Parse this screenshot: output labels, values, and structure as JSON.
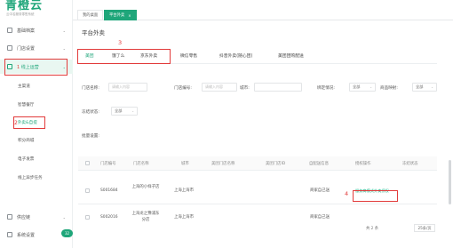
{
  "app": {
    "logo_text": "青橙云",
    "logo_sub": "云中名服务零售系统"
  },
  "sidebar": {
    "items": [
      {
        "label": "基础档案",
        "chevron": "⌄"
      },
      {
        "label": "门店设置",
        "chevron": "⌄"
      },
      {
        "label": "线上运营",
        "chevron": "⌄",
        "prefix": "1"
      },
      {
        "label": "供应链",
        "chevron": "⌄"
      },
      {
        "label": "系统设置",
        "chevron": "⌄"
      }
    ],
    "sub_items": [
      {
        "label": "主渠道"
      },
      {
        "label": "智慧餐厅"
      },
      {
        "label": "外卖&自提",
        "prefix": "2"
      },
      {
        "label": "积分商城"
      },
      {
        "label": "电子发票"
      },
      {
        "label": "线上异步任务"
      }
    ],
    "badge": "32"
  },
  "tabs": [
    {
      "label": "我的桌面"
    },
    {
      "label": "平台外卖",
      "close": "×"
    }
  ],
  "page": {
    "title": "平台外卖"
  },
  "channel_tabs": [
    {
      "label": "美团"
    },
    {
      "label": "饿了么"
    },
    {
      "label": "京东外卖"
    },
    {
      "label": "微信零售"
    },
    {
      "label": "抖音外卖(随心团)"
    },
    {
      "label": "美团团购配送"
    }
  ],
  "annotations": {
    "n3": "3",
    "n4": "4"
  },
  "filters": {
    "store_name_label": "门店名称:",
    "store_name_placeholder": "请输入内容",
    "store_code_label": "门店编号:",
    "store_code_placeholder": "请输入内容",
    "city_label": "城市:",
    "bind_label": "绑定情况:",
    "bind_value": "全部",
    "product_map_label": "商品映射:",
    "product_map_value": "全部",
    "status_label": "冻结状态:",
    "status_value": "全部",
    "batch_label": "批量设置:",
    "arrow": "⌄"
  },
  "table": {
    "headers": [
      "门店编号",
      "门店名称",
      "城市",
      "美团门店名称",
      "美团门店ID",
      "自配送信息",
      "授权操作",
      "冻结状态"
    ],
    "rows": [
      {
        "code": "S001684",
        "name": "上海的小样子店",
        "city": "上海上海市",
        "self_delivery": "商家自己送",
        "action": "服务商模式外卖授权"
      },
      {
        "code": "S002016",
        "name": "上海龙之豫浦东分店",
        "city": "上海上海市",
        "self_delivery": "商家自己送",
        "action": ""
      }
    ]
  },
  "pager": {
    "total": "共 2 条",
    "size": "25条/页"
  },
  "colors": {
    "accent": "#1fa67a",
    "annotation": "#e23b3b"
  }
}
